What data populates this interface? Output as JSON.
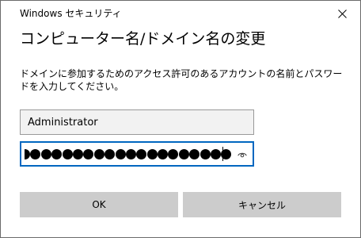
{
  "window": {
    "title": "Windows セキュリティ"
  },
  "dialog": {
    "heading": "コンピューター名/ドメイン名の変更",
    "description": "ドメインに参加するためのアクセス許可のあるアカウントの名前とパスワードを入力してください。"
  },
  "username": {
    "value": "Administrator"
  },
  "password": {
    "masked_char_count": 20
  },
  "buttons": {
    "ok_label": "OK",
    "cancel_label": "キャンセル"
  },
  "colors": {
    "focus_border": "#0067c0",
    "button_bg": "#cccccc",
    "field_bg": "#f2f2f2"
  },
  "icons": {
    "close": "close-icon",
    "reveal": "eye-icon"
  }
}
